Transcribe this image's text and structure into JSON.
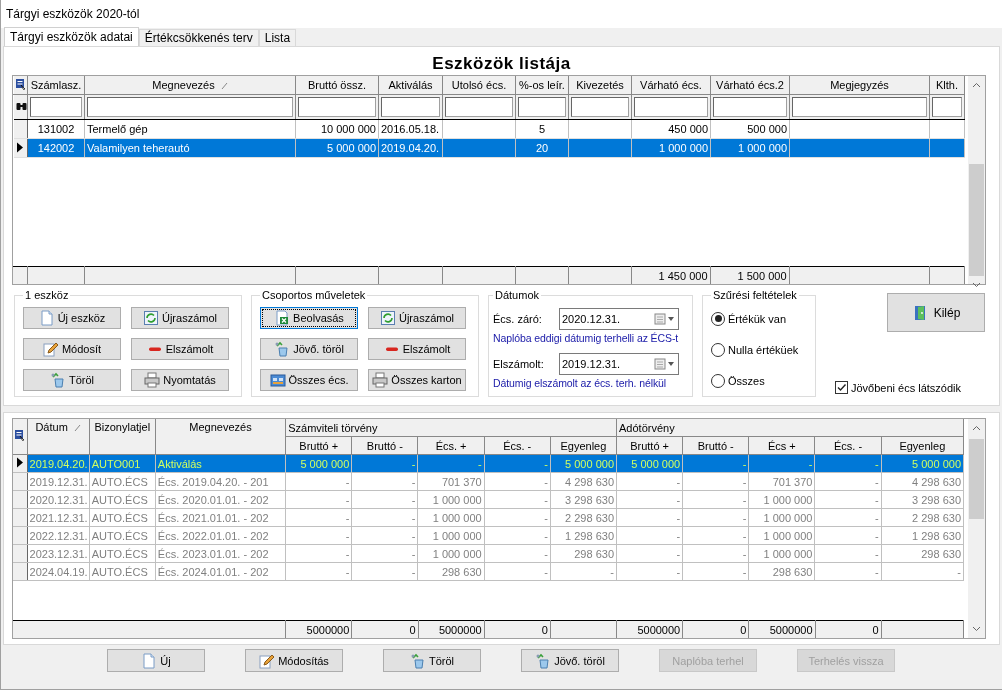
{
  "window": {
    "title": "Tárgyi eszközök 2020-tól"
  },
  "tabs": [
    {
      "label": "Tárgyi eszközök adatai",
      "selected": true
    },
    {
      "label": "Értékcsökkenés terv",
      "selected": false
    },
    {
      "label": "Lista",
      "selected": false
    }
  ],
  "asset_list": {
    "title": "Eszközök listája",
    "columns": [
      {
        "label": "Számlasz.",
        "sorted": false
      },
      {
        "label": "Megnevezés",
        "sorted": true
      },
      {
        "label": "Bruttó össz.",
        "sorted": false
      },
      {
        "label": "Aktiválás",
        "sorted": false
      },
      {
        "label": "Utolsó écs.",
        "sorted": false
      },
      {
        "label": "%-os leír.",
        "sorted": false
      },
      {
        "label": "Kivezetés",
        "sorted": false
      },
      {
        "label": "Várható écs.",
        "sorted": false,
        "total": "1 450 000"
      },
      {
        "label": "Várható écs.2",
        "sorted": false,
        "total": "1 500 000"
      },
      {
        "label": "Megjegyzés",
        "sorted": false
      },
      {
        "label": "Klth.",
        "sorted": false
      }
    ],
    "rows": [
      {
        "selected": false,
        "cells": [
          "131002",
          "Termelő gép",
          "10 000 000",
          "2016.05.18.",
          null,
          "5",
          null,
          "450 000",
          "500 000",
          null,
          null
        ]
      },
      {
        "selected": true,
        "cells": [
          "142002",
          "Valamilyen teherautó",
          "5 000 000",
          "2019.04.20.",
          null,
          "20",
          null,
          "1 000 000",
          "1 000 000",
          null,
          null
        ]
      }
    ]
  },
  "single_asset": {
    "title": "1 eszköz",
    "buttons": [
      {
        "label": "Új eszköz",
        "focused": false
      },
      {
        "label": "Újraszámol",
        "focused": false
      },
      {
        "label": "Módosít",
        "focused": false
      },
      {
        "label": "Elszámolt",
        "focused": false
      },
      {
        "label": "Töröl",
        "focused": false
      },
      {
        "label": "Nyomtatás",
        "focused": false
      }
    ]
  },
  "group_actions": {
    "title": "Csoportos műveletek",
    "buttons": [
      {
        "label": "Beolvasás",
        "focused": true
      },
      {
        "label": "Újraszámol",
        "focused": false
      },
      {
        "label": "Jövő. töröl",
        "focused": false
      },
      {
        "label": "Elszámolt",
        "focused": false
      },
      {
        "label": "Összes écs.",
        "focused": false
      },
      {
        "label": "Összes karton",
        "focused": false
      }
    ]
  },
  "dates": {
    "title": "Dátumok",
    "fields": [
      {
        "label": "Écs. záró:",
        "value": "2020.12.31.",
        "note": "Naplóba eddigi dátumig terhelli az ÉCS-t"
      },
      {
        "label": "Elszámolt:",
        "value": "2019.12.31.",
        "note": "Dátumig elszámolt az écs. terh. nélkül"
      }
    ]
  },
  "filters": {
    "title": "Szűrési feltételek",
    "options": [
      {
        "label": "Értékük van",
        "selected": true
      },
      {
        "label": "Nulla értéküek",
        "selected": false
      },
      {
        "label": "Összes",
        "selected": false
      }
    ]
  },
  "exit_button": {
    "label": "Kilép"
  },
  "future_checkbox": {
    "label": "Jövőbeni écs látszódik",
    "checked": true
  },
  "journal": {
    "lead_columns": [
      {
        "label": "Dátum",
        "sorted": true
      },
      {
        "label": "Bizonylatjel",
        "sorted": false
      },
      {
        "label": "Megnevezés",
        "sorted": false
      }
    ],
    "groups": [
      {
        "label": "Számviteli törvény",
        "columns": [
          {
            "label": "Bruttó +",
            "total": "5000000"
          },
          {
            "label": "Bruttó -",
            "total": "0"
          },
          {
            "label": "Écs. +",
            "total": "5000000"
          },
          {
            "label": "Écs. -",
            "total": "0"
          },
          {
            "label": "Egyenleg"
          }
        ]
      },
      {
        "label": "Adótörvény",
        "columns": [
          {
            "label": "Bruttó +",
            "total": "5000000"
          },
          {
            "label": "Bruttó -",
            "total": "0"
          },
          {
            "label": "Écs +",
            "total": "5000000"
          },
          {
            "label": "Écs. -",
            "total": "0"
          },
          {
            "label": "Egyenleg"
          }
        ]
      }
    ],
    "rows": [
      {
        "selected": true,
        "cells": [
          "2019.04.20.",
          "AUTO001",
          "Aktiválás",
          "5 000 000",
          "-",
          "-",
          "-",
          "5 000 000",
          "5 000 000",
          "-",
          "-",
          "-",
          "5 000 000"
        ]
      },
      {
        "selected": false,
        "cells": [
          "2019.12.31.",
          "AUTO.ÉCS",
          "Écs. 2019.04.20. - 201",
          "-",
          "-",
          "701 370",
          "-",
          "4 298 630",
          "-",
          "-",
          "701 370",
          "-",
          "4 298 630"
        ]
      },
      {
        "selected": false,
        "cells": [
          "2020.12.31.",
          "AUTO.ÉCS",
          "Écs. 2020.01.01. - 202",
          "-",
          "-",
          "1 000 000",
          "-",
          "3 298 630",
          "-",
          "-",
          "1 000 000",
          "-",
          "3 298 630"
        ]
      },
      {
        "selected": false,
        "cells": [
          "2021.12.31.",
          "AUTO.ÉCS",
          "Écs. 2021.01.01. - 202",
          "-",
          "-",
          "1 000 000",
          "-",
          "2 298 630",
          "-",
          "-",
          "1 000 000",
          "-",
          "2 298 630"
        ]
      },
      {
        "selected": false,
        "cells": [
          "2022.12.31.",
          "AUTO.ÉCS",
          "Écs. 2022.01.01. - 202",
          "-",
          "-",
          "1 000 000",
          "-",
          "1 298 630",
          "-",
          "-",
          "1 000 000",
          "-",
          "1 298 630"
        ]
      },
      {
        "selected": false,
        "cells": [
          "2023.12.31.",
          "AUTO.ÉCS",
          "Écs. 2023.01.01. - 202",
          "-",
          "-",
          "1 000 000",
          "-",
          "298 630",
          "-",
          "-",
          "1 000 000",
          "-",
          "298 630"
        ]
      },
      {
        "selected": false,
        "cells": [
          "2024.04.19.",
          "AUTO.ÉCS",
          "Écs. 2024.01.01. - 202",
          "-",
          "-",
          "298 630",
          "-",
          "-",
          "-",
          "-",
          "298 630",
          "-",
          "-"
        ]
      }
    ]
  },
  "buttons": [
    {
      "label": "Új",
      "disabled": false
    },
    {
      "label": "Módosítás",
      "disabled": false
    },
    {
      "label": "Töröl",
      "disabled": false
    },
    {
      "label": "Jövő. töröl",
      "disabled": false
    },
    {
      "label": "Naplóba terhel",
      "disabled": true
    },
    {
      "label": "Terhelés vissza",
      "disabled": true
    }
  ]
}
